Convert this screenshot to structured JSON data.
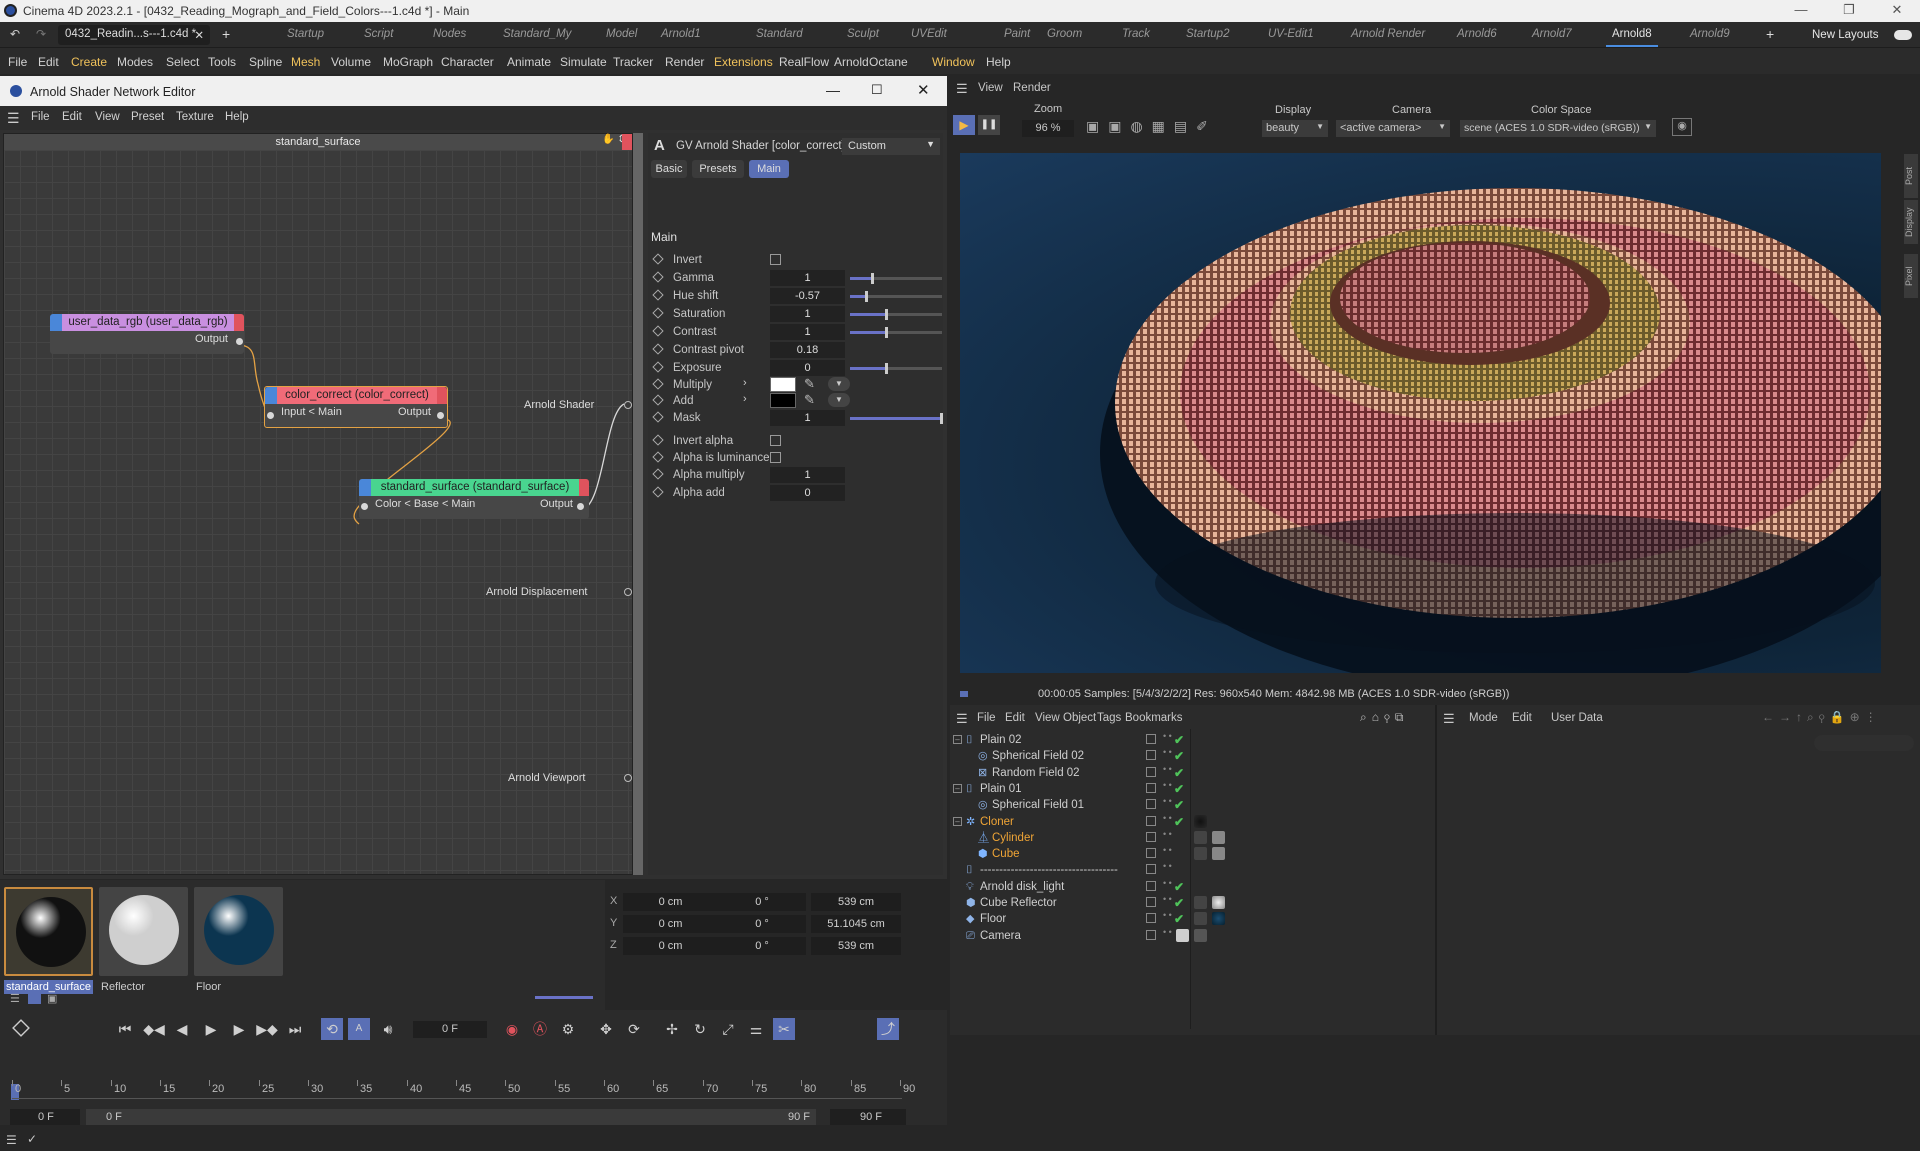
{
  "app": {
    "title": "Cinema 4D 2023.2.1 - [0432_Reading_Mograph_and_Field_Colors---1.c4d *] - Main",
    "doc_tab": "0432_Readin...s---1.c4d *",
    "new_layouts": "New Layouts"
  },
  "layouts": [
    "Startup",
    "Script",
    "Nodes",
    "Standard_My",
    "Model",
    "Arnold1",
    "Standard",
    "Sculpt",
    "UVEdit",
    "Paint",
    "Groom",
    "Track",
    "Startup2",
    "UV-Edit1",
    "Arnold Render",
    "Arnold6",
    "Arnold7",
    "Arnold8",
    "Arnold9"
  ],
  "active_layout": "Arnold8",
  "menus": [
    "File",
    "Edit",
    "Create",
    "Modes",
    "Select",
    "Tools",
    "Spline",
    "Mesh",
    "Volume",
    "MoGraph",
    "Character",
    "Animate",
    "Simulate",
    "Tracker",
    "Render",
    "Extensions",
    "RealFlow",
    "Arnold",
    "Octane",
    "Window",
    "Help"
  ],
  "shader_editor": {
    "title": "Arnold Shader Network Editor",
    "menus": [
      "File",
      "Edit",
      "View",
      "Preset",
      "Texture",
      "Help"
    ],
    "graph_title": "standard_surface",
    "nodes": {
      "user_data": {
        "title": "user_data_rgb (user_data_rgb)",
        "output": "Output",
        "color": "#c98fe0"
      },
      "color_correct": {
        "title": "color_correct (color_correct)",
        "input": "Input < Main",
        "output": "Output",
        "color": "#f06b78"
      },
      "standard_surface": {
        "title": "standard_surface (standard_surface)",
        "input": "Color < Base < Main",
        "output": "Output",
        "color": "#49d58f"
      }
    },
    "outputs": [
      "Arnold Shader",
      "Arnold Displacement",
      "Arnold Viewport"
    ],
    "attr": {
      "header": "GV Arnold Shader [color_correct]",
      "preset": "Custom",
      "tabs": [
        "Basic",
        "Presets",
        "Main"
      ],
      "active_tab": "Main",
      "section": "Main",
      "params": [
        {
          "label": "Invert",
          "type": "check"
        },
        {
          "label": "Gamma",
          "value": "1",
          "slider": 0.25
        },
        {
          "label": "Hue shift",
          "value": "-0.57",
          "slider": 0.18
        },
        {
          "label": "Saturation",
          "value": "1",
          "slider": 0.4
        },
        {
          "label": "Contrast",
          "value": "1",
          "slider": 0.4
        },
        {
          "label": "Contrast pivot",
          "value": "0.18"
        },
        {
          "label": "Exposure",
          "value": "0",
          "slider": 0.4
        },
        {
          "label": "Multiply",
          "type": "color",
          "color": "#ffffff"
        },
        {
          "label": "Add",
          "type": "color",
          "color": "#000000"
        },
        {
          "label": "Mask",
          "value": "1",
          "slider": 1.0
        },
        {
          "label": "Invert alpha",
          "type": "check"
        },
        {
          "label": "Alpha is luminance",
          "type": "check"
        },
        {
          "label": "Alpha multiply",
          "value": "1"
        },
        {
          "label": "Alpha add",
          "value": "0"
        }
      ]
    }
  },
  "viewport": {
    "menus": [
      "View",
      "Render"
    ],
    "zoom_label": "Zoom",
    "zoom": "96 %",
    "display_label": "Display",
    "display": "beauty",
    "camera_label": "Camera",
    "camera": "<active camera>",
    "colorspace_label": "Color Space",
    "colorspace": "scene (ACES 1.0 SDR-video (sRGB))",
    "side_tabs": [
      "Post",
      "Display",
      "Pixel"
    ],
    "status": "00:00:05  Samples: [5/4/3/2/2/2]  Res: 960x540  Mem: 4842.98 MB  (ACES 1.0 SDR-video (sRGB))"
  },
  "object_manager": {
    "menus": [
      "File",
      "Edit",
      "View",
      "Object",
      "Tags",
      "Bookmarks"
    ],
    "attr_menus": [
      "Mode",
      "Edit",
      "User Data"
    ],
    "objects": [
      {
        "name": "Plain 02",
        "indent": 0,
        "icon": "plain-effector-icon",
        "check": true
      },
      {
        "name": "Spherical Field 02",
        "indent": 1,
        "icon": "spherical-field-icon",
        "check": true
      },
      {
        "name": "Random Field 02",
        "indent": 1,
        "icon": "random-field-icon",
        "check": true
      },
      {
        "name": "Plain 01",
        "indent": 0,
        "icon": "plain-effector-icon",
        "check": true
      },
      {
        "name": "Spherical Field 01",
        "indent": 1,
        "icon": "spherical-field-icon",
        "check": true
      },
      {
        "name": "Cloner",
        "indent": 0,
        "icon": "cloner-icon",
        "check": true,
        "orange": true
      },
      {
        "name": "Cylinder",
        "indent": 1,
        "icon": "cylinder-icon",
        "check": false,
        "orange": true
      },
      {
        "name": "Cube",
        "indent": 1,
        "icon": "cube-icon",
        "check": false,
        "orange": true
      },
      {
        "name": "------------------------------------",
        "indent": 0,
        "icon": "null-icon",
        "check": false
      },
      {
        "name": "Arnold disk_light",
        "indent": 0,
        "icon": "light-icon",
        "check": true
      },
      {
        "name": "Cube Reflector",
        "indent": 0,
        "icon": "cube-icon",
        "check": true
      },
      {
        "name": "Floor",
        "indent": 0,
        "icon": "floor-icon",
        "check": true
      },
      {
        "name": "Camera",
        "indent": 0,
        "icon": "camera-icon",
        "check": false
      }
    ]
  },
  "materials": [
    {
      "name": "standard_surface",
      "color": "#111111"
    },
    {
      "name": "Reflector",
      "color": "#cfcfcf"
    },
    {
      "name": "Floor",
      "color": "#0c3550"
    }
  ],
  "coords": {
    "labels": [
      "X",
      "Y",
      "Z"
    ],
    "pos": [
      "0 cm",
      "0 cm",
      "0 cm"
    ],
    "rot": [
      "0 °",
      "0 °",
      "0 °"
    ],
    "size": [
      "539 cm",
      "51.1045 cm",
      "539 cm"
    ]
  },
  "timeline": {
    "frame": "0 F",
    "ticks": [
      "0",
      "5",
      "10",
      "15",
      "20",
      "25",
      "30",
      "35",
      "40",
      "45",
      "50",
      "55",
      "60",
      "65",
      "70",
      "75",
      "80",
      "85",
      "90"
    ],
    "start": "0 F",
    "min": "0 F",
    "max": "90 F",
    "end": "90 F"
  }
}
